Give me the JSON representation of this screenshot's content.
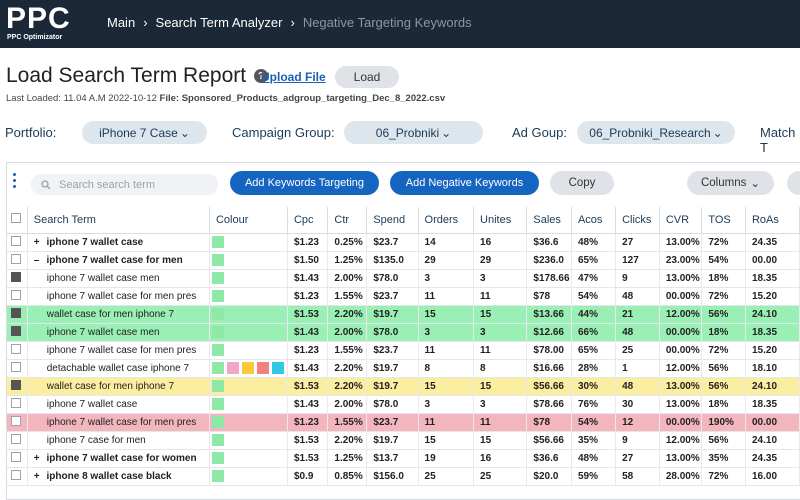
{
  "header": {
    "logo": "PPC",
    "logo_sub": "PPC Optimizator",
    "breadcrumbs": [
      "Main",
      "Search Term Analyzer",
      "Negative Targeting Keywords"
    ]
  },
  "report": {
    "title": "Load Search Term Report",
    "upload_label": "Upload File",
    "load_label": "Load",
    "last_loaded_label": "Last Loaded: 11.04 A.M 2022-10-12",
    "file_label": "File:",
    "file_name": "Sponsored_Products_adgroup_targeting_Dec_8_2022.csv"
  },
  "filters": {
    "portfolio_label": "Portfolio:",
    "portfolio_value": "iPhone 7 Case",
    "campaign_label": "Campaign Group:",
    "campaign_value": "06_Probniki",
    "adgroup_label": "Ad Goup:",
    "adgroup_value": "06_Probniki_Research",
    "match_label": "Match T"
  },
  "toolbar": {
    "search_placeholder": "Search search term",
    "add_keywords": "Add Keywords Targeting",
    "add_negative": "Add Negative Keywords",
    "copy": "Copy",
    "columns": "Columns"
  },
  "colors": {
    "green_row": "#9af0b4",
    "yellow_row": "#fbeea0",
    "pink_row": "#f4b6be",
    "swatch_green": "#8ee8a6",
    "swatch_pink": "#f4a6c8",
    "swatch_yellow": "#f8c93c",
    "swatch_red": "#f28080",
    "swatch_cyan": "#33c7e6",
    "brand_blue": "#1565c0"
  },
  "table": {
    "columns": [
      "Search Term",
      "Colour",
      "Cpc",
      "Ctr",
      "Spend",
      "Orders",
      "Unites",
      "Sales",
      "Acos",
      "Clicks",
      "CVR",
      "TOS",
      "RoAs"
    ],
    "rows": [
      {
        "expander": "+",
        "term": "iphone 7 wallet case",
        "bold": true,
        "checked": false,
        "style": "",
        "colour": [
          "green"
        ],
        "cpc": "$1.23",
        "ctr": "0.25%",
        "spend": "$23.7",
        "orders": "14",
        "unites": "16",
        "sales": "$36.6",
        "acos": "48%",
        "clicks": "27",
        "cvr": "13.00%",
        "tos": "72%",
        "roas": "24.35"
      },
      {
        "expander": "–",
        "term": "iphone 7 wallet case for men",
        "bold": true,
        "checked": false,
        "style": "",
        "colour": [
          "green"
        ],
        "cpc": "$1.50",
        "ctr": "1.25%",
        "spend": "$135.0",
        "orders": "29",
        "unites": "29",
        "sales": "$236.0",
        "acos": "65%",
        "clicks": "127",
        "cvr": "23.00%",
        "tos": "54%",
        "roas": "00.00"
      },
      {
        "expander": "",
        "term": "iphone 7 wallet case men",
        "bold": false,
        "checked": true,
        "style": "",
        "colour": [
          "green"
        ],
        "cpc": "$1.43",
        "ctr": "2.00%",
        "spend": "$78.0",
        "orders": "3",
        "unites": "3",
        "sales": "$178.66",
        "acos": "47%",
        "clicks": "9",
        "cvr": "13.00%",
        "tos": "18%",
        "roas": "18.35"
      },
      {
        "expander": "",
        "term": "iphone 7 wallet case for men pres",
        "bold": false,
        "checked": false,
        "style": "",
        "colour": [
          "green"
        ],
        "cpc": "$1.23",
        "ctr": "1.55%",
        "spend": "$23.7",
        "orders": "11",
        "unites": "11",
        "sales": "$78",
        "acos": "54%",
        "clicks": "48",
        "cvr": "00.00%",
        "tos": "72%",
        "roas": "15.20"
      },
      {
        "expander": "",
        "term": "wallet case for men iphone 7",
        "bold": false,
        "checked": true,
        "style": "green",
        "colour": [
          "green"
        ],
        "cpc": "$1.53",
        "ctr": "2.20%",
        "spend": "$19.7",
        "orders": "15",
        "unites": "15",
        "sales": "$13.66",
        "acos": "44%",
        "clicks": "21",
        "cvr": "12.00%",
        "tos": "56%",
        "roas": "24.10"
      },
      {
        "expander": "",
        "term": "iphone 7 wallet case men",
        "bold": false,
        "checked": true,
        "style": "green",
        "colour": [
          "green"
        ],
        "cpc": "$1.43",
        "ctr": "2.00%",
        "spend": "$78.0",
        "orders": "3",
        "unites": "3",
        "sales": "$12.66",
        "acos": "66%",
        "clicks": "48",
        "cvr": "00.00%",
        "tos": "18%",
        "roas": "18.35"
      },
      {
        "expander": "",
        "term": "iphone 7 wallet case for men pres",
        "bold": false,
        "checked": false,
        "style": "",
        "colour": [
          "green"
        ],
        "cpc": "$1.23",
        "ctr": "1.55%",
        "spend": "$23.7",
        "orders": "11",
        "unites": "11",
        "sales": "$78.00",
        "acos": "65%",
        "clicks": "25",
        "cvr": "00.00%",
        "tos": "72%",
        "roas": "15.20"
      },
      {
        "expander": "",
        "term": "detachable wallet case iphone 7",
        "bold": false,
        "checked": false,
        "style": "",
        "colour": [
          "green",
          "pink",
          "yellow",
          "red",
          "cyan"
        ],
        "cpc": "$1.43",
        "ctr": "2.20%",
        "spend": "$19.7",
        "orders": "8",
        "unites": "8",
        "sales": "$16.66",
        "acos": "28%",
        "clicks": "1",
        "cvr": "12.00%",
        "tos": "56%",
        "roas": "18.10"
      },
      {
        "expander": "",
        "term": "wallet case for men iphone 7",
        "bold": false,
        "checked": true,
        "style": "yellow",
        "colour": [
          "green"
        ],
        "cpc": "$1.53",
        "ctr": "2.20%",
        "spend": "$19.7",
        "orders": "15",
        "unites": "15",
        "sales": "$56.66",
        "acos": "30%",
        "clicks": "48",
        "cvr": "13.00%",
        "tos": "56%",
        "roas": "24.10"
      },
      {
        "expander": "",
        "term": "iphone 7 wallet case",
        "bold": false,
        "checked": false,
        "style": "",
        "colour": [
          "green"
        ],
        "cpc": "$1.43",
        "ctr": "2.00%",
        "spend": "$78.0",
        "orders": "3",
        "unites": "3",
        "sales": "$78.66",
        "acos": "76%",
        "clicks": "30",
        "cvr": "13.00%",
        "tos": "18%",
        "roas": "18.35"
      },
      {
        "expander": "",
        "term": "iphone 7 wallet case for men pres",
        "bold": false,
        "checked": false,
        "style": "pink",
        "colour": [
          "green"
        ],
        "cpc": "$1.23",
        "ctr": "1.55%",
        "spend": "$23.7",
        "orders": "11",
        "unites": "11",
        "sales": "$78",
        "acos": "54%",
        "clicks": "12",
        "cvr": "00.00%",
        "tos": "190%",
        "roas": "00.00"
      },
      {
        "expander": "",
        "term": "iphone 7 case for men",
        "bold": false,
        "checked": false,
        "style": "",
        "colour": [
          "green"
        ],
        "cpc": "$1.53",
        "ctr": "2.20%",
        "spend": "$19.7",
        "orders": "15",
        "unites": "15",
        "sales": "$56.66",
        "acos": "35%",
        "clicks": "9",
        "cvr": "12.00%",
        "tos": "56%",
        "roas": "24.10"
      },
      {
        "expander": "+",
        "term": "iphone 7 wallet case for women",
        "bold": true,
        "checked": false,
        "style": "",
        "colour": [
          "green"
        ],
        "cpc": "$1.53",
        "ctr": "1.25%",
        "spend": "$13.7",
        "orders": "19",
        "unites": "16",
        "sales": "$36.6",
        "acos": "48%",
        "clicks": "27",
        "cvr": "13.00%",
        "tos": "35%",
        "roas": "24.35"
      },
      {
        "expander": "+",
        "term": "iphone 8 wallet case black",
        "bold": true,
        "checked": false,
        "style": "",
        "colour": [
          "green"
        ],
        "cpc": "$0.9",
        "ctr": "0.85%",
        "spend": "$156.0",
        "orders": "25",
        "unites": "25",
        "sales": "$20.0",
        "acos": "59%",
        "clicks": "58",
        "cvr": "28.00%",
        "tos": "72%",
        "roas": "16.00"
      }
    ]
  }
}
